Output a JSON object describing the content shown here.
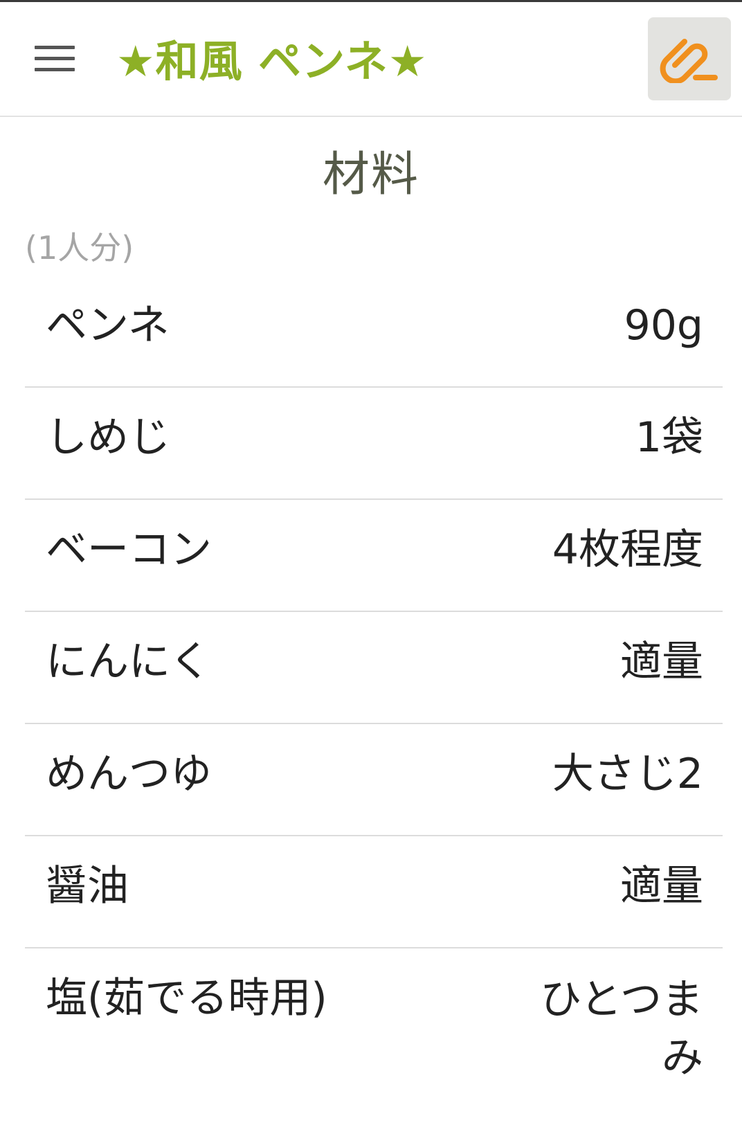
{
  "header": {
    "title": "★和風 ペンネ★",
    "menu_icon": "hamburger-menu-icon",
    "clip_icon": "paperclip-icon",
    "accent_color": "#8db026",
    "clip_color": "#f0901e"
  },
  "section": {
    "title": "材料",
    "servings": "(1人分)"
  },
  "ingredients": [
    {
      "name": "ペンネ",
      "qty": "90g"
    },
    {
      "name": "しめじ",
      "qty": "1袋"
    },
    {
      "name": "ベーコン",
      "qty": "4枚程度"
    },
    {
      "name": "にんにく",
      "qty": "適量"
    },
    {
      "name": "めんつゆ",
      "qty": "大さじ2"
    },
    {
      "name": "醤油",
      "qty": "適量"
    },
    {
      "name": "塩(茹でる時用)",
      "qty": "ひとつまみ"
    }
  ]
}
